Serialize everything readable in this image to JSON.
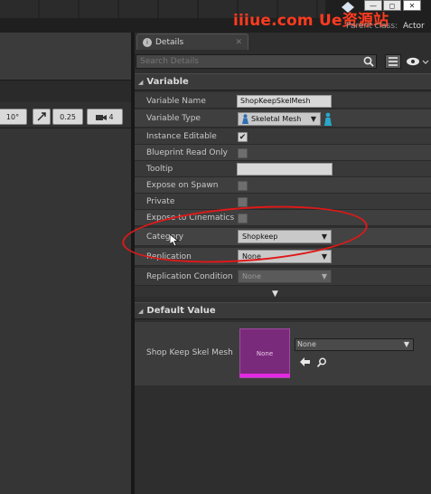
{
  "watermark": "iiiue.com Ue资源站",
  "titlebar": {
    "minimize_glyph": "—",
    "maximize_glyph": "◻",
    "close_glyph": "✕",
    "parent_class_label": "Parent class:",
    "parent_class_value": "Actor"
  },
  "viewport": {
    "snap_angle": "10°",
    "scale_snap": "0.25",
    "camera_speed": "4"
  },
  "details_tab": {
    "label": "Details",
    "close": "✕"
  },
  "search": {
    "placeholder": "Search Details"
  },
  "variable_section": {
    "title": "Variable",
    "rows": {
      "variable_name": {
        "label": "Variable Name",
        "value": "ShopKeepSkelMesh"
      },
      "variable_type": {
        "label": "Variable Type",
        "value": "Skeletal Mesh"
      },
      "instance_editable": {
        "label": "Instance Editable",
        "checked": true
      },
      "blueprint_read_only": {
        "label": "Blueprint Read Only",
        "checked": false
      },
      "tooltip": {
        "label": "Tooltip",
        "value": ""
      },
      "expose_on_spawn": {
        "label": "Expose on Spawn",
        "checked": false
      },
      "private": {
        "label": "Private",
        "checked": false
      },
      "expose_to_cinematics": {
        "label": "Expose to Cinematics",
        "checked": false
      },
      "category": {
        "label": "Category",
        "value": "Shopkeep"
      },
      "replication": {
        "label": "Replication",
        "value": "None"
      },
      "replication_condition": {
        "label": "Replication Condition",
        "value": "None"
      }
    }
  },
  "default_value_section": {
    "title": "Default Value",
    "property_label": "Shop Keep Skel Mesh",
    "thumbnail_text": "None",
    "asset_value": "None"
  },
  "colors": {
    "highlight_ellipse": "#e01818",
    "mesh_thumbnail": "#7a2a7a",
    "mesh_type_bar": "#e22ae2",
    "watermark": "#ff3b1f"
  }
}
